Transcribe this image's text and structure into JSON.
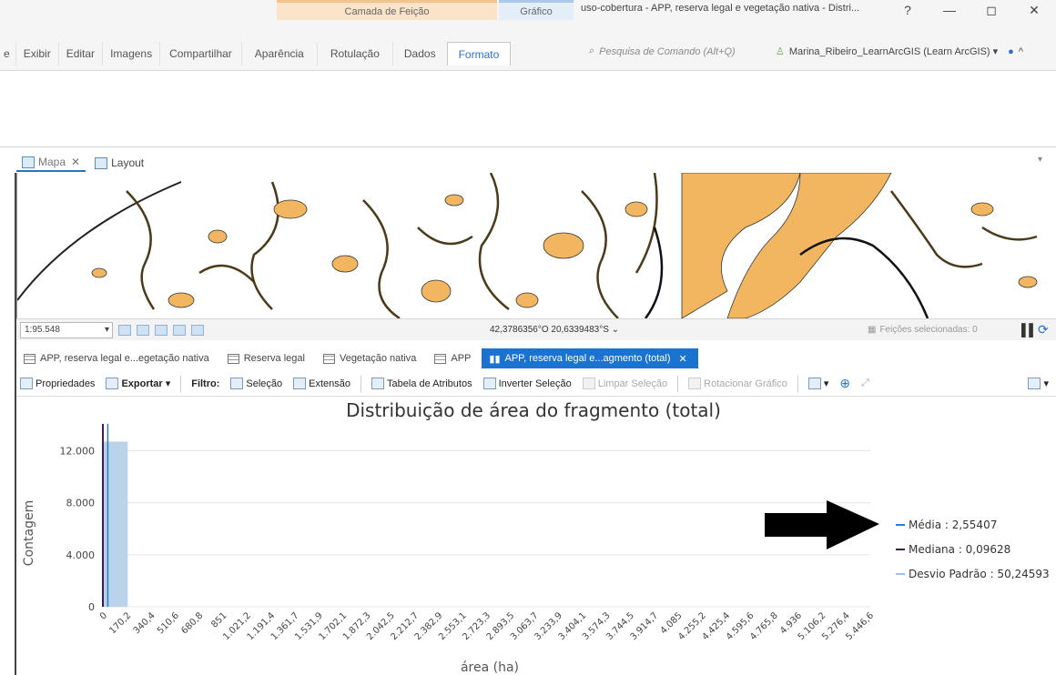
{
  "ribbon": {
    "context_feature_layer": "Camada de Feição",
    "context_chart": "Gráfico",
    "window_title": "uso-cobertura - APP, reserva legal e vegetação nativa - Distri...",
    "help": "?",
    "minimize": "—",
    "restore": "◻",
    "close": "✕",
    "tabs": [
      {
        "label": "e"
      },
      {
        "label": "Exibir"
      },
      {
        "label": "Editar"
      },
      {
        "label": "Imagens"
      },
      {
        "label": "Compartilhar"
      },
      {
        "label": "Aparência"
      },
      {
        "label": "Rotulação"
      },
      {
        "label": "Dados"
      },
      {
        "label": "Formato"
      }
    ],
    "search_placeholder": "Pesquisa de Comando (Alt+Q)",
    "user": "Marina_Ribeiro_LearnArcGIS (Learn ArcGIS) ▾"
  },
  "views": {
    "map_tab": "Mapa",
    "layout_tab": "Layout"
  },
  "map_status": {
    "scale": "1:95.548",
    "coordinates": "42,3786356°O 20,6339483°S",
    "selected_features": "Feições selecionadas: 0"
  },
  "table_tabs": [
    {
      "label": "APP, reserva legal e...egetação nativa"
    },
    {
      "label": "Reserva legal"
    },
    {
      "label": "Vegetação nativa"
    },
    {
      "label": "APP"
    },
    {
      "label": "APP, reserva legal e...agmento (total)"
    }
  ],
  "chart_toolbar": {
    "properties": "Propriedades",
    "export": "Exportar",
    "filter": "Filtro:",
    "selection": "Seleção",
    "extent": "Extensão",
    "attribute_table": "Tabela de Atributos",
    "invert_selection": "Inverter Seleção",
    "clear_selection": "Limpar Seleção",
    "rotate_chart": "Rotacionar Gráfico"
  },
  "colors": {
    "accent": "#1a73d1",
    "bar": "#b9d3ea",
    "mean_line": "#2f7bd1",
    "median_line": "#3a1d4f",
    "std_line": "#9ec3e8",
    "map_fill": "#f2b661"
  },
  "chart_data": {
    "type": "bar",
    "title": "Distribuição de área do fragmento (total)",
    "xlabel": "área (ha)",
    "ylabel": "Contagem",
    "ylim": [
      0,
      13500
    ],
    "yticks": [
      0,
      4000,
      8000,
      12000
    ],
    "ytick_labels": [
      "0",
      "4.000",
      "8.000",
      "12.000"
    ],
    "x_ticks": [
      "0",
      "170,2",
      "340,4",
      "510,6",
      "680,8",
      "851",
      "1.021,2",
      "1.191,4",
      "1.361,7",
      "1.531,9",
      "1.702,1",
      "1.872,3",
      "2.042,5",
      "2.212,7",
      "2.382,9",
      "2.553,1",
      "2.723,3",
      "2.893,5",
      "3.063,7",
      "3.233,9",
      "3.404,1",
      "3.574,3",
      "3.744,5",
      "3.914,7",
      "4.085",
      "4.255,2",
      "4.425,4",
      "4.595,6",
      "4.765,8",
      "4.936",
      "5.106,2",
      "5.276,4",
      "5.446,6"
    ],
    "x_range": [
      0,
      5446.6
    ],
    "bins": [
      {
        "start": 0,
        "end": 170.2,
        "count": 12700
      }
    ],
    "grid": true,
    "legend_position": "right",
    "legend": [
      {
        "label": "Média : 2,55407",
        "key": "mean",
        "value": 2.55407
      },
      {
        "label": "Mediana : 0,09628",
        "key": "median",
        "value": 0.09628
      },
      {
        "label": "Desvio Padrão : 50,24593",
        "key": "std",
        "value": 50.24593
      }
    ]
  }
}
